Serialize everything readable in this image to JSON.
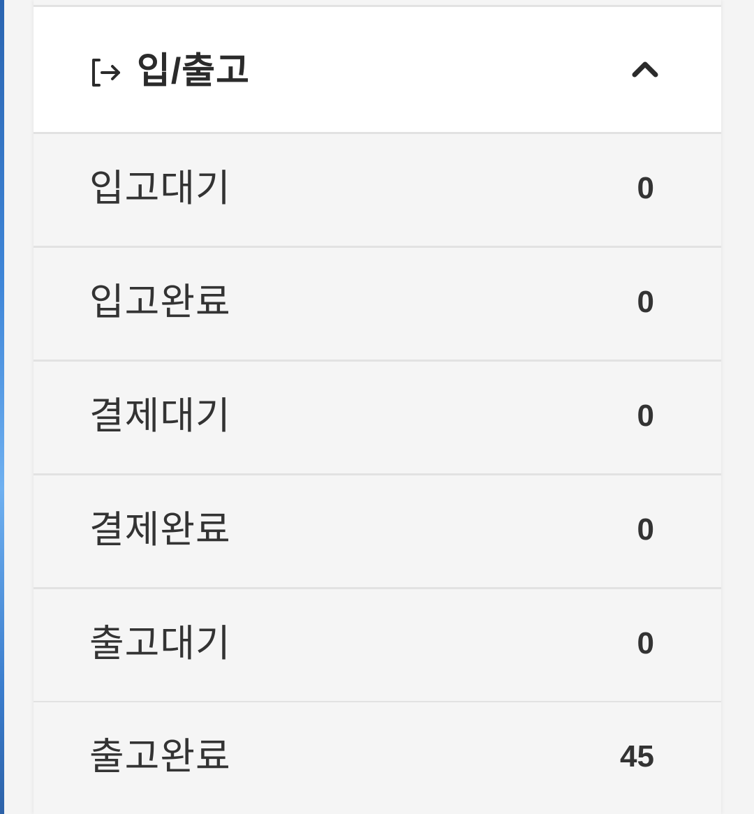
{
  "section": {
    "title": "입/출고",
    "icon": "sign-in-icon",
    "toggle_icon": "chevron-up-icon",
    "expanded": true
  },
  "items": [
    {
      "label": "입고대기",
      "count": "0"
    },
    {
      "label": "입고완료",
      "count": "0"
    },
    {
      "label": "결제대기",
      "count": "0"
    },
    {
      "label": "결제완료",
      "count": "0"
    },
    {
      "label": "출고대기",
      "count": "0"
    },
    {
      "label": "출고완료",
      "count": "45"
    }
  ]
}
